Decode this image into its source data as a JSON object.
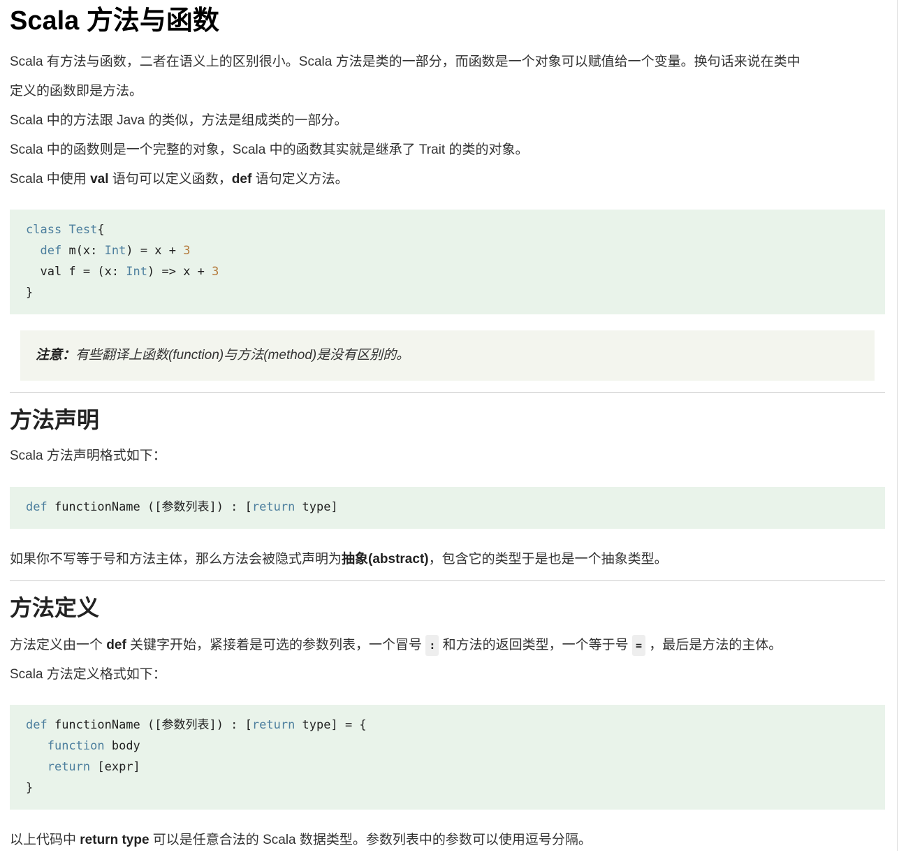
{
  "title": "Scala 方法与函数",
  "intro": {
    "line1": "Scala 有方法与函数，二者在语义上的区别很小。Scala 方法是类的一部分，而函数是一个对象可以赋值给一个变量。换句话来说在类中",
    "line2": "定义的函数即是方法。",
    "line3": "Scala 中的方法跟 Java 的类似，方法是组成类的一部分。",
    "line4": "Scala 中的函数则是一个完整的对象，Scala 中的函数其实就是继承了 Trait 的类的对象。",
    "line5_a": "Scala 中使用 ",
    "line5_val": "val",
    "line5_b": " 语句可以定义函数，",
    "line5_def": "def",
    "line5_c": " 语句定义方法。"
  },
  "code1": {
    "l1_kw": "class",
    "l1_name": "Test",
    "l1_brace": "{",
    "l2_def": "def",
    "l2_a": " m(x: ",
    "l2_type": "Int",
    "l2_b": ") = x + ",
    "l2_num": "3",
    "l3_a": "  val f = (x: ",
    "l3_type": "Int",
    "l3_b": ") => x + ",
    "l3_num": "3",
    "l4": "}"
  },
  "note": {
    "label": "注意：",
    "text": "有些翻译上函数(function)与方法(method)是没有区别的。"
  },
  "section1": {
    "heading": "方法声明",
    "desc": "Scala 方法声明格式如下：",
    "code_def": "def",
    "code_a": " functionName ([参数列表]) : [",
    "code_return": "return",
    "code_b": " type]",
    "after_a": "如果你不写等于号和方法主体，那么方法会被隐式声明为",
    "after_bold": "抽象(abstract)",
    "after_b": "，包含它的类型于是也是一个抽象类型。"
  },
  "section2": {
    "heading": "方法定义",
    "p1_a": "方法定义由一个 ",
    "p1_def": "def",
    "p1_b": " 关键字开始，紧接着是可选的参数列表，一个冒号 ",
    "p1_colon": ":",
    "p1_c": " 和方法的返回类型，一个等于号 ",
    "p1_eq": "=",
    "p1_d": " ，最后是方法的主体。",
    "p2": "Scala 方法定义格式如下：",
    "code_l1_def": "def",
    "code_l1_a": " functionName ([参数列表]) : [",
    "code_l1_return": "return",
    "code_l1_b": " type] = {",
    "code_l2_kw": "function",
    "code_l2_b": " body",
    "code_l3_kw": "return",
    "code_l3_b": " [expr]",
    "code_l4": "}",
    "last_a": "以上代码中 ",
    "last_bold": "return type",
    "last_b": " 可以是任意合法的 Scala 数据类型。参数列表中的参数可以使用逗号分隔。"
  }
}
